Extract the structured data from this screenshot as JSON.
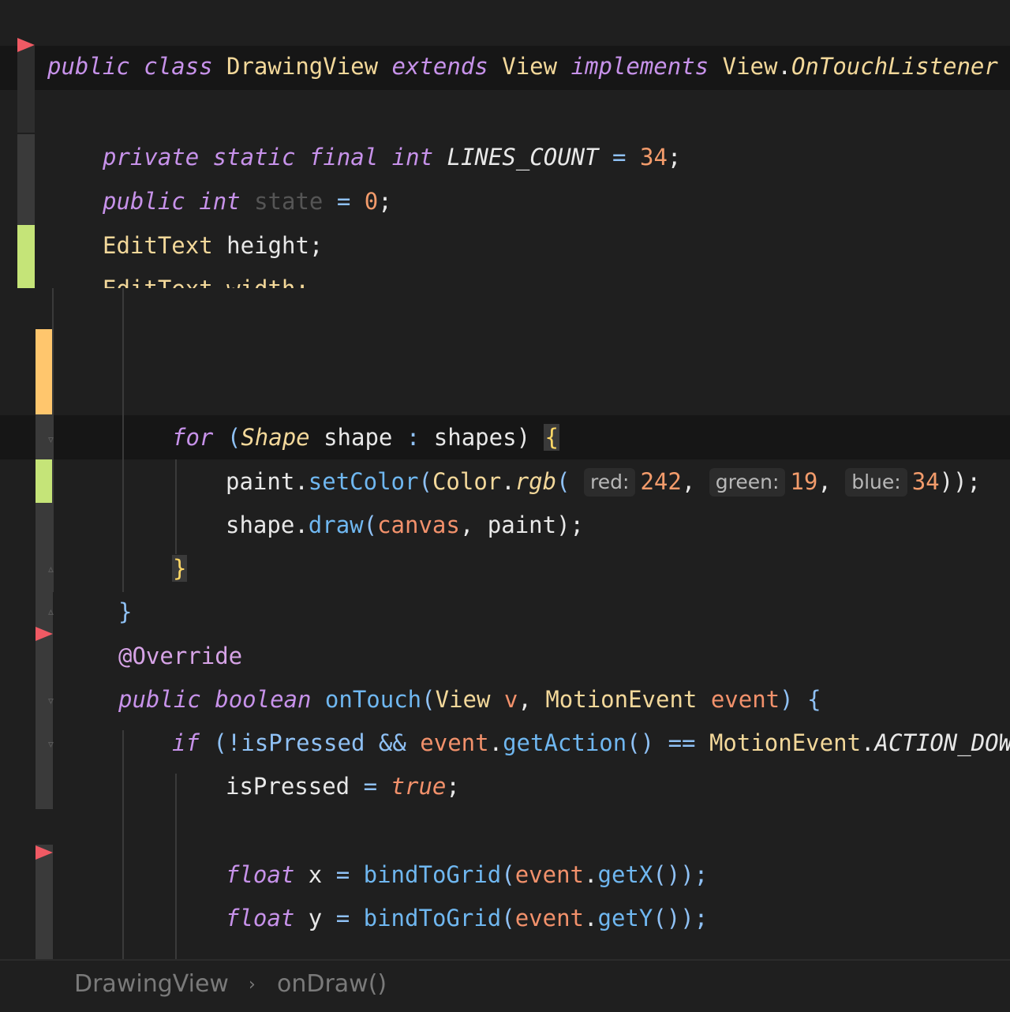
{
  "editor": {
    "top_snippet": {
      "class_declaration": {
        "public": "public",
        "class": "class",
        "name": "DrawingView",
        "extends": "extends",
        "parent": "View",
        "implements": "implements",
        "iface_owner": "View",
        "iface_name": "OnTouchListener"
      },
      "field_lines_count": {
        "modifiers": "private static final",
        "type": "int",
        "name": "LINES_COUNT",
        "op": " = ",
        "value": "34",
        "end": ";"
      },
      "field_state": {
        "modifiers": "public",
        "type": "int",
        "name": "state",
        "op": " = ",
        "value": "0",
        "end": ";"
      },
      "field_height": {
        "type": "EditText",
        "name": "height",
        "end": ";"
      },
      "partial_line": "EditText width;"
    },
    "main_snippet": {
      "for_line": {
        "kw": "for",
        "open": " (",
        "type": "Shape",
        "var": "shape",
        "colon": " : ",
        "iter": "shapes",
        "close": ") ",
        "brace": "{"
      },
      "set_color_line": {
        "obj": "paint",
        "method": "setColor",
        "cls": "Color",
        "fn": "rgb",
        "hint_red": "red:",
        "red": "242",
        "hint_green": "green:",
        "green": "19",
        "hint_blue": "blue:",
        "blue": "34",
        "tail": "));"
      },
      "draw_line": {
        "obj": "shape",
        "method": "draw",
        "arg1": "canvas",
        "arg2": "paint",
        "tail": ");"
      },
      "close_inner": "}",
      "close_outer": "}",
      "annotation": "@Override",
      "on_touch_sig": {
        "mod": "public",
        "ret": "boolean",
        "name": "onTouch",
        "ptype1": "View",
        "p1": "v",
        "ptype2": "MotionEvent",
        "p2": "event",
        "open": ") {"
      },
      "if_line": {
        "kw": "if",
        "cond_start": " (!isPressed && ",
        "obj": "event",
        "method": "getAction",
        "eq": "() == ",
        "cls": "MotionEvent",
        "const": "ACTION_DOWN",
        "tail": ")"
      },
      "pressed_line": {
        "var": "isPressed",
        "op": " = ",
        "value": "true",
        "end": ";"
      },
      "float_x": {
        "type": "float",
        "var": "x",
        "op": " = ",
        "fn": "bindToGrid",
        "obj": "event",
        "method": "getX",
        "tail": "());"
      },
      "float_y": {
        "type": "float",
        "var": "y",
        "op": " = ",
        "fn": "bindToGrid",
        "obj": "event",
        "method": "getY",
        "tail": "());"
      }
    }
  },
  "breadcrumb": {
    "class_name": "DrawingView",
    "separator": "›",
    "method_name": "onDraw()"
  },
  "colors": {
    "background": "#1f1f1f",
    "keyword": "#c792ea",
    "type": "#f3d89a",
    "number": "#f29b6b",
    "function": "#6fb7f0",
    "gutter_added": "#c5e478",
    "gutter_modified": "#ffc66d",
    "breakpoint_flag": "#f05a64"
  },
  "icons": [
    "bookmark-flag-icon",
    "fold-arrow-icon"
  ]
}
